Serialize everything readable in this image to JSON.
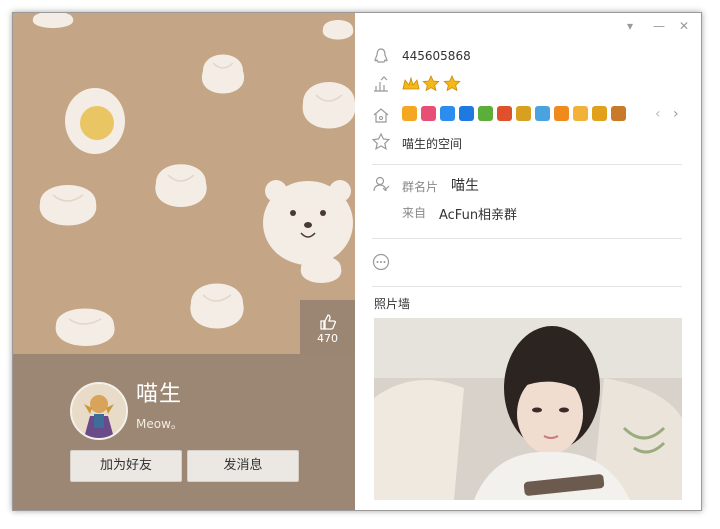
{
  "window": {
    "controls": [
      "▾",
      "—",
      "✕"
    ]
  },
  "left_panel": {
    "like_count": "470",
    "nickname": "喵生",
    "signature": "Meow。",
    "buttons": {
      "add_friend": "加为好友",
      "send_message": "发消息"
    }
  },
  "right_panel": {
    "qq_number": "445605868",
    "level_icons": [
      "crown-icon",
      "star-icon",
      "star-icon"
    ],
    "service_badges": [
      {
        "name": "star-badge",
        "color": "#f5a623"
      },
      {
        "name": "colorful-badge",
        "color": "#e94e77"
      },
      {
        "name": "camera-badge",
        "color": "#2d8cf0"
      },
      {
        "name": "shield-badge",
        "color": "#1e7ae0"
      },
      {
        "name": "game-badge",
        "color": "#5cae3a"
      },
      {
        "name": "red-badge",
        "color": "#e0502d"
      },
      {
        "name": "yellow-badge",
        "color": "#d8a020"
      },
      {
        "name": "mail-badge",
        "color": "#4aa3df"
      },
      {
        "name": "orange-badge",
        "color": "#f08a1c"
      },
      {
        "name": "person-badge",
        "color": "#f2b23a"
      },
      {
        "name": "gold-badge",
        "color": "#e2a11a"
      },
      {
        "name": "chest-badge",
        "color": "#c97a28"
      }
    ],
    "qzone_link": "喵生的空间",
    "group_card_label": "群名片",
    "group_card_name": "喵生",
    "from_label": "来自",
    "from_group": "AcFun相亲群",
    "photo_wall_title": "照片墙"
  }
}
